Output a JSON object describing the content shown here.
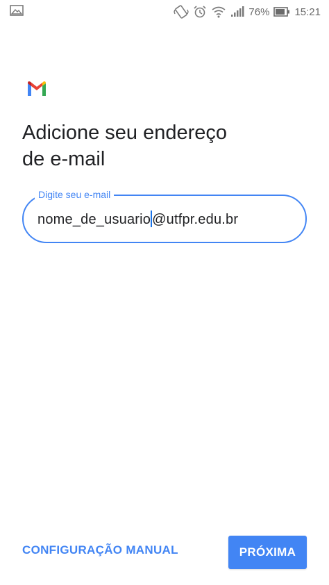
{
  "status_bar": {
    "battery_percent": "76%",
    "time": "15:21",
    "icons": [
      "image-icon",
      "vibrate-icon",
      "alarm-icon",
      "wifi-icon",
      "signal-icon",
      "battery-icon"
    ]
  },
  "logo": {
    "name": "gmail-logo-icon",
    "colors": [
      "#4285f4",
      "#ea4335",
      "#fbbc04",
      "#34a853",
      "#c5221f"
    ]
  },
  "heading": {
    "line1": "Adicione seu endereço",
    "line2": "de e-mail"
  },
  "email_field": {
    "label": "Digite seu e-mail",
    "value_before_cursor": "nome_de_usuario",
    "value_after_cursor": "@utfpr.edu.br",
    "accent_color": "#4285f4"
  },
  "actions": {
    "manual_label": "CONFIGURAÇÃO MANUAL",
    "next_label": "PRÓXIMA",
    "accent_color": "#4285f4"
  }
}
